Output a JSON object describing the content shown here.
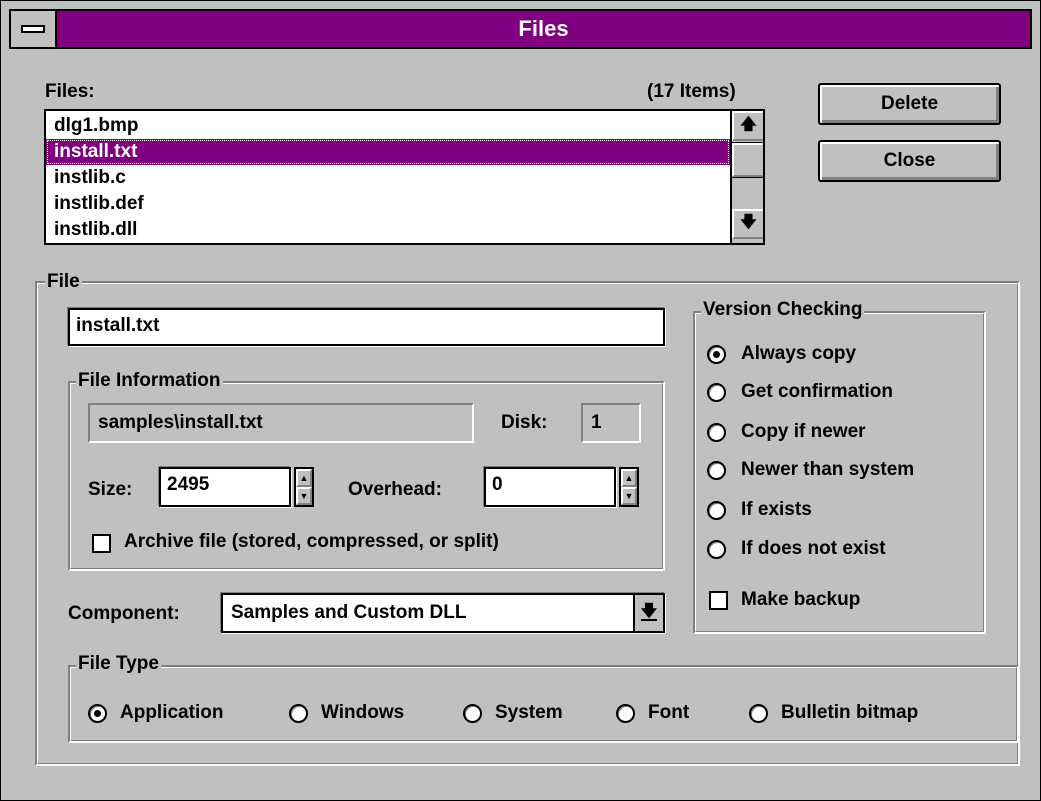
{
  "window": {
    "title": "Files"
  },
  "files_list": {
    "label": "Files:",
    "count_label": "(17 Items)",
    "items": [
      "dlg1.bmp",
      "install.txt",
      "instlib.c",
      "instlib.def",
      "instlib.dll"
    ],
    "selected_index": 1
  },
  "buttons": {
    "delete": "Delete",
    "close": "Close"
  },
  "file_group": {
    "label": "File",
    "name_value": "install.txt",
    "info": {
      "label": "File Information",
      "path_value": "samples\\install.txt",
      "disk_label": "Disk:",
      "disk_value": "1",
      "size_label": "Size:",
      "size_value": "2495",
      "overhead_label": "Overhead:",
      "overhead_value": "0",
      "archive_label": "Archive file (stored, compressed, or split)",
      "archive_checked": false
    },
    "component_label": "Component:",
    "component_value": "Samples and Custom DLL"
  },
  "version_checking": {
    "label": "Version Checking",
    "options": [
      "Always copy",
      "Get confirmation",
      "Copy if newer",
      "Newer than system",
      "If exists",
      "If does not exist"
    ],
    "selected_index": 0,
    "make_backup_label": "Make backup",
    "make_backup_checked": false
  },
  "file_type": {
    "label": "File Type",
    "options": [
      "Application",
      "Windows",
      "System",
      "Font",
      "Bulletin bitmap"
    ],
    "selected_index": 0
  },
  "icons": {
    "system_menu": "system-menu-icon",
    "scroll_up": "arrow-up-icon",
    "scroll_down": "arrow-down-icon",
    "spin_up": "spin-up-icon",
    "spin_down": "spin-down-icon",
    "dropdown": "dropdown-arrow-icon"
  },
  "colors": {
    "title_bar": "#800080",
    "selection": "#800080",
    "face": "#c0c0c0"
  }
}
